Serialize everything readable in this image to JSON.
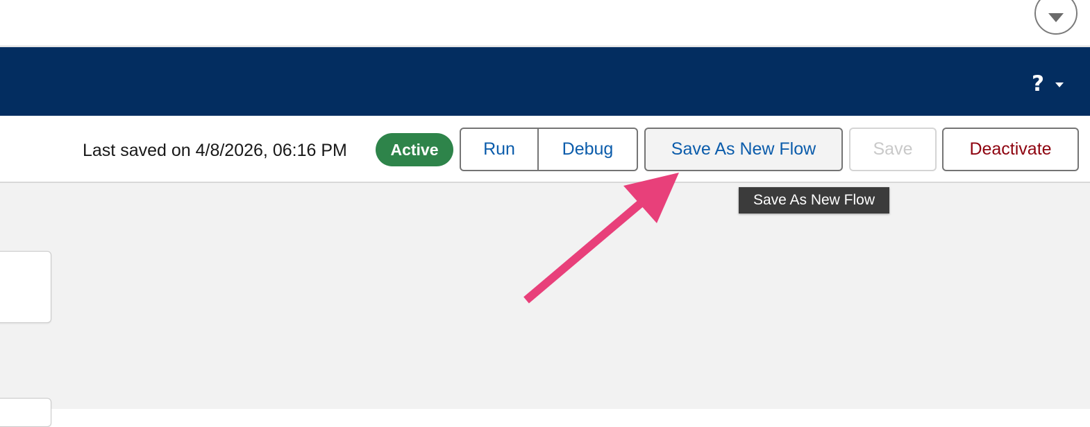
{
  "header": {
    "help_icon": "question-icon",
    "help_label": "?",
    "menu_icon": "chevron-down-icon"
  },
  "toolbar": {
    "last_saved": "Last saved on 4/8/2026, 06:16 PM",
    "status": "Active",
    "run_label": "Run",
    "debug_label": "Debug",
    "save_as_label": "Save As New Flow",
    "save_label": "Save",
    "deactivate_label": "Deactivate"
  },
  "tooltip": {
    "text": "Save As New Flow"
  },
  "annotation": {
    "arrow_color": "#e8407a"
  },
  "colors": {
    "nav_background": "#032d60",
    "status_active": "#2e844a",
    "link_blue": "#0b5cab",
    "destructive_red": "#8e030f"
  }
}
